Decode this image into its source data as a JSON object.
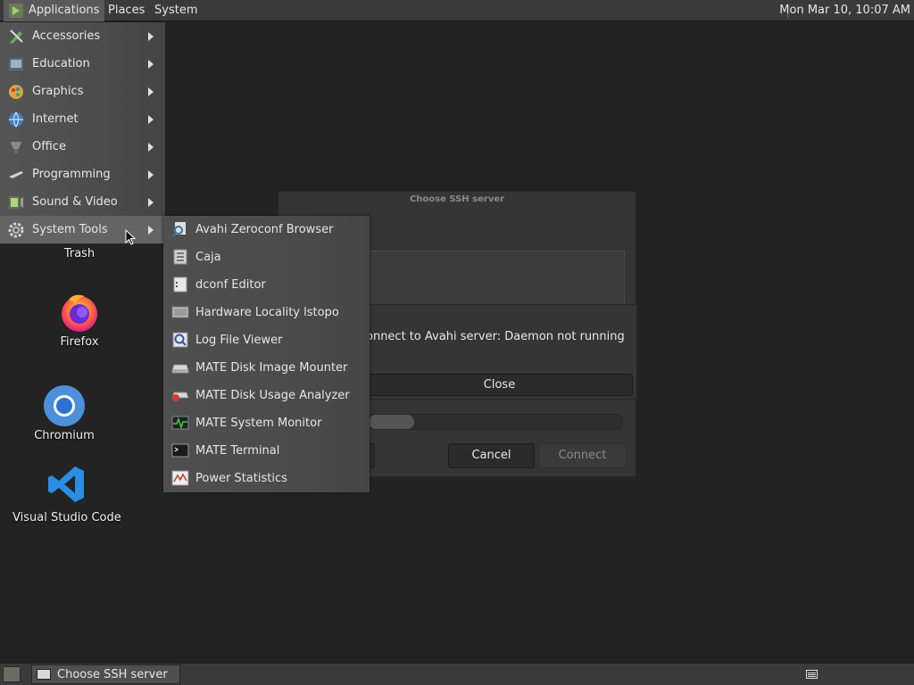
{
  "top_panel": {
    "applications": "Applications",
    "places": "Places",
    "system": "System",
    "clock": "Mon Mar 10, 10:07 AM"
  },
  "desktop_icons": {
    "trash": "Trash",
    "firefox": "Firefox",
    "chromium": "Chromium",
    "vscode": "Visual Studio Code"
  },
  "ssh_dialog": {
    "title": "Choose SSH server",
    "cancel": "Cancel",
    "connect": "Connect",
    "progress": 0.18
  },
  "error_dialog": {
    "message": "onnect to Avahi server: Daemon not running",
    "close": "Close"
  },
  "applications_menu": [
    {
      "label": "Accessories",
      "icon": "accessories-icon"
    },
    {
      "label": "Education",
      "icon": "education-icon"
    },
    {
      "label": "Graphics",
      "icon": "graphics-icon"
    },
    {
      "label": "Internet",
      "icon": "internet-icon"
    },
    {
      "label": "Office",
      "icon": "office-icon"
    },
    {
      "label": "Programming",
      "icon": "programming-icon"
    },
    {
      "label": "Sound & Video",
      "icon": "sound-video-icon"
    },
    {
      "label": "System Tools",
      "icon": "system-tools-icon"
    }
  ],
  "system_tools_menu": [
    {
      "label": "Avahi Zeroconf Browser",
      "icon": "avahi-icon"
    },
    {
      "label": "Caja",
      "icon": "caja-icon"
    },
    {
      "label": "dconf Editor",
      "icon": "dconf-icon"
    },
    {
      "label": "Hardware Locality lstopo",
      "icon": "lstopo-icon"
    },
    {
      "label": "Log File Viewer",
      "icon": "log-viewer-icon"
    },
    {
      "label": "MATE Disk Image Mounter",
      "icon": "disk-mounter-icon"
    },
    {
      "label": "MATE Disk Usage Analyzer",
      "icon": "disk-usage-icon"
    },
    {
      "label": "MATE System Monitor",
      "icon": "system-monitor-icon"
    },
    {
      "label": "MATE Terminal",
      "icon": "terminal-icon"
    },
    {
      "label": "Power Statistics",
      "icon": "power-stats-icon"
    }
  ],
  "taskbar": {
    "window_title": "Choose SSH server"
  },
  "colors": {
    "desktop_bg": "#232323",
    "panel_bg": "#3a3a3a",
    "menu_active": "#646464",
    "firefox_orange": "#ff7139",
    "chromium_blue": "#4e8fd9",
    "vscode_blue": "#2a8ee6"
  }
}
